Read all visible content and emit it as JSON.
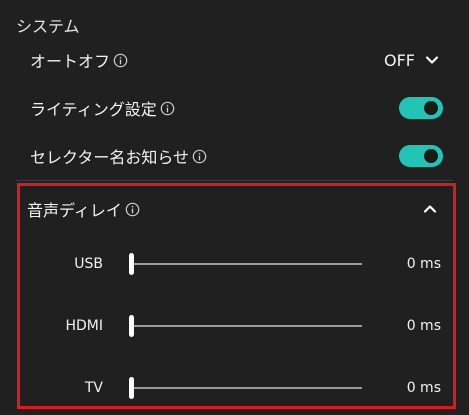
{
  "section": {
    "title": "システム"
  },
  "auto_off": {
    "label": "オートオフ",
    "value": "OFF"
  },
  "lighting": {
    "label": "ライティング設定",
    "enabled": true
  },
  "selector_notice": {
    "label": "セレクター名お知らせ",
    "enabled": true
  },
  "audio_delay": {
    "label": "音声ディレイ",
    "expanded": true,
    "sliders": [
      {
        "label": "USB",
        "value": "0 ms",
        "level": 0
      },
      {
        "label": "HDMI",
        "value": "0 ms",
        "level": 0
      },
      {
        "label": "TV",
        "value": "0 ms",
        "level": 0
      }
    ]
  },
  "colors": {
    "background": "#202020",
    "toggle_on": "#22c4b6",
    "highlight_border": "#e0181c"
  },
  "icons": {
    "info": "info-icon",
    "dropdown": "chevron-down-icon",
    "collapse": "chevron-up-icon"
  }
}
